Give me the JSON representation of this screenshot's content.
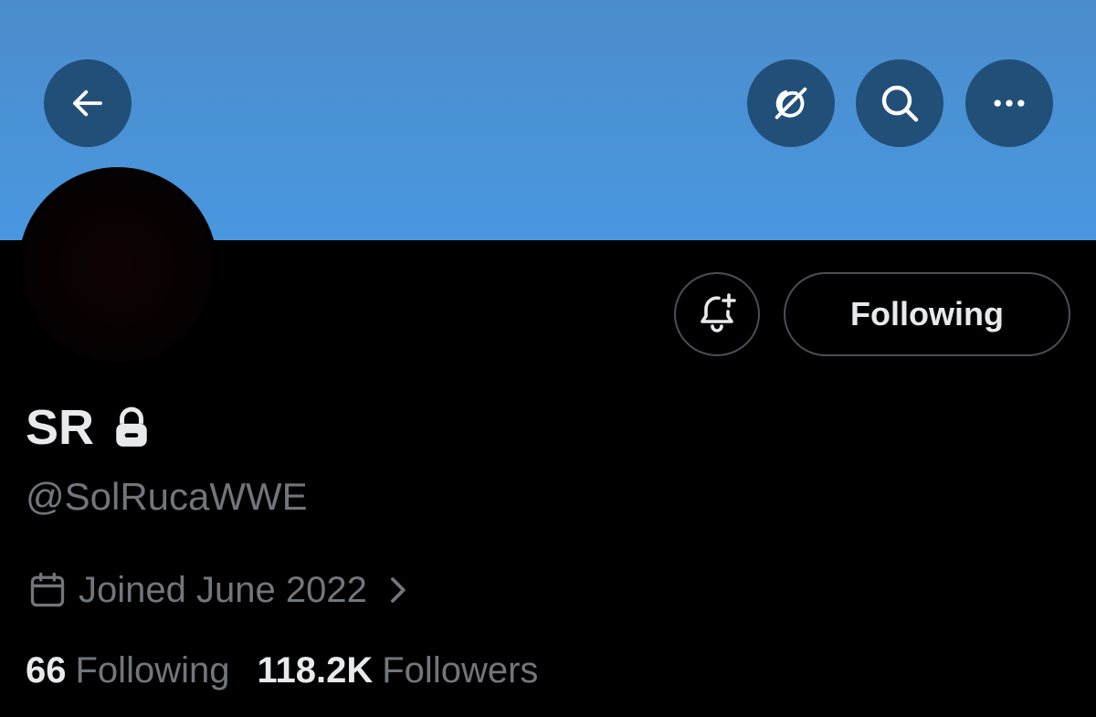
{
  "header": {
    "back_icon": "arrow-left-icon",
    "grok_icon": "grok-icon",
    "search_icon": "search-icon",
    "more_icon": "more-horizontal-icon",
    "banner_color": "#4a93d8"
  },
  "profile": {
    "display_name": "SR",
    "protected_icon": "lock-icon",
    "handle": "@SolRucaWWE",
    "joined_text": "Joined June 2022",
    "calendar_icon": "calendar-icon",
    "chevron_icon": "chevron-right-icon"
  },
  "actions": {
    "notify_icon": "bell-plus-icon",
    "following_button_label": "Following"
  },
  "stats": {
    "following_count": "66",
    "following_label": "Following",
    "followers_count": "118.2K",
    "followers_label": "Followers"
  },
  "colors": {
    "background": "#000000",
    "primary_text": "#e7e9ea",
    "secondary_text": "#71767b",
    "button_dark": "#224f78"
  }
}
